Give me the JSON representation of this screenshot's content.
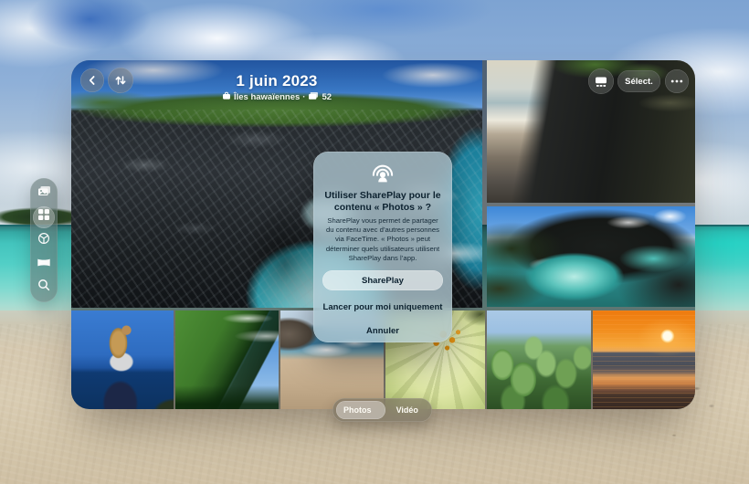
{
  "header": {
    "date": "1 juin 2023",
    "location": "Îles hawaïennes",
    "separator": "·",
    "photo_count": "52",
    "select_label": "Sélect."
  },
  "icons": {
    "back": "chevron-left-icon",
    "sort": "arrows-up-down-icon",
    "view": "immersive-view-icon",
    "select": "select-pill",
    "more": "ellipsis-icon",
    "location": "suitcase-icon",
    "count": "photo-stack-icon",
    "sidebar": [
      "photos-library-icon",
      "albums-grid-icon",
      "spatial-sphere-icon",
      "panorama-icon",
      "search-icon"
    ],
    "dialog": "shareplay-icon"
  },
  "sidebar": {
    "items": [
      {
        "name": "library",
        "selected": false
      },
      {
        "name": "albums",
        "selected": true
      },
      {
        "name": "spatial",
        "selected": false
      },
      {
        "name": "panoramas",
        "selected": false
      },
      {
        "name": "search",
        "selected": false
      }
    ]
  },
  "dialog": {
    "title": "Utiliser SharePlay pour le contenu « Photos » ?",
    "body": "SharePlay vous permet de partager du contenu avec d’autres personnes via FaceTime. « Photos » peut déterminer quels utilisateurs utilisent SharePlay dans l’app.",
    "primary_label": "SharePlay",
    "secondary_label": "Lancer pour moi uniquement",
    "cancel_label": "Annuler"
  },
  "tab_bar": {
    "photos_label": "Photos",
    "video_label": "Vidéo",
    "selected": "Photos"
  },
  "photos": {
    "hero": "volcanic-coastline",
    "right_top": "lava-rock-cave-beach",
    "right_middle": "black-rock-cove",
    "bottom_row": [
      "woman-overlook",
      "green-cliffs",
      "beach-surf",
      "yellow-flower",
      "cactus",
      "sunset-beach"
    ]
  },
  "colors": {
    "ocean_turquoise": "#4cc9c2",
    "sand": "#d6c9b0",
    "sky": "#8fb0d8",
    "dialog_glass": "#adc4ce",
    "text_on_glass": "#0d2230",
    "white": "#ffffff"
  }
}
